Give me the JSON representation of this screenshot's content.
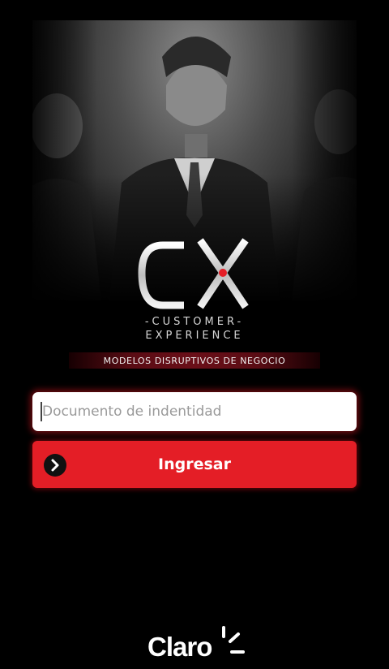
{
  "hero": {
    "photo_icon": "people-photo"
  },
  "logo": {
    "mark": "CX",
    "line1": "-CUSTOMER-",
    "line2": "EXPERIENCE"
  },
  "banner": {
    "text": "MODELOS DISRUPTIVOS DE NEGOCIO"
  },
  "login": {
    "document_placeholder": "Documento de indentidad",
    "document_value": "",
    "submit_label": "Ingresar",
    "submit_icon": "chevron-right-icon"
  },
  "brand": {
    "name": "Claro"
  },
  "colors": {
    "accent": "#e41e26",
    "banner": "#5a0c14",
    "background": "#000000"
  }
}
